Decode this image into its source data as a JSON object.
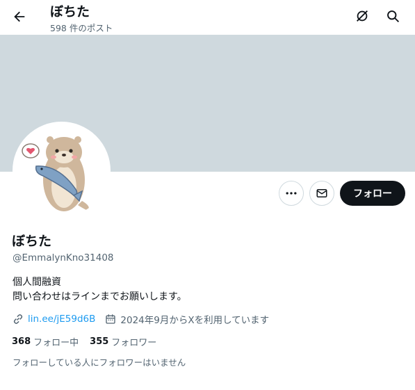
{
  "header": {
    "title": "ぼちた",
    "posts": "598 件のポスト"
  },
  "profile": {
    "name": "ぼちた",
    "handle": "@EmmalynKno31408",
    "bio_line1": "個人間融資",
    "bio_line2": "問い合わせはラインまでお願いします。",
    "link": "lin.ee/jE59d6B",
    "joined": "2024年9月からXを利用しています"
  },
  "actions": {
    "follow": "フォロー"
  },
  "stats": {
    "following_count": "368",
    "following_label": "フォロー中",
    "followers_count": "355",
    "followers_label": "フォロワー"
  },
  "note": "フォローしている人にフォロワーはいません",
  "icons": [
    "back-arrow-icon",
    "grok-icon",
    "search-icon",
    "more-icon",
    "mail-icon",
    "link-icon",
    "calendar-icon"
  ],
  "colors": {
    "banner": "#cfd9de",
    "link": "#1d9bf0",
    "button": "#0f1419",
    "muted": "#536471"
  }
}
